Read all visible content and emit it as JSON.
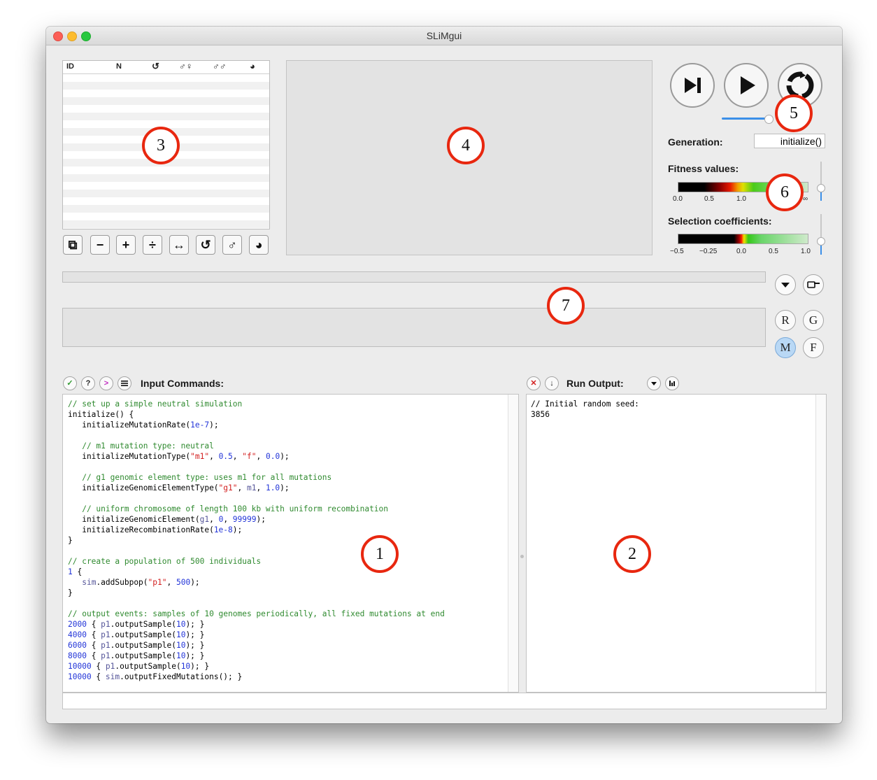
{
  "window": {
    "title": "SLiMgui"
  },
  "subpop_table": {
    "columns": [
      "ID",
      "N",
      "↺",
      "♂♀",
      "♂♂",
      "◕"
    ]
  },
  "toolbar_buttons": [
    "⧉",
    "−",
    "+",
    "÷",
    "↔",
    "↺",
    "♂",
    "◕"
  ],
  "generation": {
    "label": "Generation:",
    "value": "initialize()"
  },
  "fitness": {
    "label": "Fitness values:",
    "ticks": [
      "0.0",
      "0.5",
      "1.0",
      "∞"
    ]
  },
  "selection": {
    "label": "Selection coefficients:",
    "ticks": [
      "−0.5",
      "−0.25",
      "0.0",
      "0.5",
      "1.0"
    ]
  },
  "side_buttons": {
    "r": "R",
    "g": "G",
    "m": "M",
    "f": "F"
  },
  "callouts": [
    "1",
    "2",
    "3",
    "4",
    "5",
    "6",
    "7"
  ],
  "input": {
    "header": "Input Commands:",
    "lines": [
      [
        [
          "cm",
          "// set up a simple neutral simulation"
        ]
      ],
      [
        [
          "",
          "initialize() {"
        ]
      ],
      [
        [
          "",
          "   initializeMutationRate("
        ],
        [
          "num",
          "1e-7"
        ],
        [
          "",
          ");"
        ]
      ],
      [
        [
          "",
          ""
        ]
      ],
      [
        [
          "cm",
          "   // m1 mutation type: neutral"
        ]
      ],
      [
        [
          "",
          "   initializeMutationType("
        ],
        [
          "str",
          "\"m1\""
        ],
        [
          "",
          ", "
        ],
        [
          "num",
          "0.5"
        ],
        [
          "",
          ", "
        ],
        [
          "str",
          "\"f\""
        ],
        [
          "",
          ", "
        ],
        [
          "num",
          "0.0"
        ],
        [
          "",
          ");"
        ]
      ],
      [
        [
          "",
          ""
        ]
      ],
      [
        [
          "cm",
          "   // g1 genomic element type: uses m1 for all mutations"
        ]
      ],
      [
        [
          "",
          "   initializeGenomicElementType("
        ],
        [
          "str",
          "\"g1\""
        ],
        [
          "",
          ", "
        ],
        [
          "kw",
          "m1"
        ],
        [
          "",
          ", "
        ],
        [
          "num",
          "1.0"
        ],
        [
          "",
          ");"
        ]
      ],
      [
        [
          "",
          ""
        ]
      ],
      [
        [
          "cm",
          "   // uniform chromosome of length 100 kb with uniform recombination"
        ]
      ],
      [
        [
          "",
          "   initializeGenomicElement("
        ],
        [
          "kw",
          "g1"
        ],
        [
          "",
          ", "
        ],
        [
          "num",
          "0"
        ],
        [
          "",
          ", "
        ],
        [
          "num",
          "99999"
        ],
        [
          "",
          ");"
        ]
      ],
      [
        [
          "",
          "   initializeRecombinationRate("
        ],
        [
          "num",
          "1e-8"
        ],
        [
          "",
          ");"
        ]
      ],
      [
        [
          "",
          "}"
        ]
      ],
      [
        [
          "",
          ""
        ]
      ],
      [
        [
          "cm",
          "// create a population of 500 individuals"
        ]
      ],
      [
        [
          "num",
          "1"
        ],
        [
          "",
          " {"
        ]
      ],
      [
        [
          "",
          "   "
        ],
        [
          "kw",
          "sim"
        ],
        [
          "",
          ".addSubpop("
        ],
        [
          "str",
          "\"p1\""
        ],
        [
          "",
          ", "
        ],
        [
          "num",
          "500"
        ],
        [
          "",
          ");"
        ]
      ],
      [
        [
          "",
          "}"
        ]
      ],
      [
        [
          "",
          ""
        ]
      ],
      [
        [
          "cm",
          "// output events: samples of 10 genomes periodically, all fixed mutations at end"
        ]
      ],
      [
        [
          "num",
          "2000"
        ],
        [
          "",
          " { "
        ],
        [
          "kw",
          "p1"
        ],
        [
          "",
          ".outputSample("
        ],
        [
          "num",
          "10"
        ],
        [
          "",
          "); }"
        ]
      ],
      [
        [
          "num",
          "4000"
        ],
        [
          "",
          " { "
        ],
        [
          "kw",
          "p1"
        ],
        [
          "",
          ".outputSample("
        ],
        [
          "num",
          "10"
        ],
        [
          "",
          "); }"
        ]
      ],
      [
        [
          "num",
          "6000"
        ],
        [
          "",
          " { "
        ],
        [
          "kw",
          "p1"
        ],
        [
          "",
          ".outputSample("
        ],
        [
          "num",
          "10"
        ],
        [
          "",
          "); }"
        ]
      ],
      [
        [
          "num",
          "8000"
        ],
        [
          "",
          " { "
        ],
        [
          "kw",
          "p1"
        ],
        [
          "",
          ".outputSample("
        ],
        [
          "num",
          "10"
        ],
        [
          "",
          "); }"
        ]
      ],
      [
        [
          "num",
          "10000"
        ],
        [
          "",
          " { "
        ],
        [
          "kw",
          "p1"
        ],
        [
          "",
          ".outputSample("
        ],
        [
          "num",
          "10"
        ],
        [
          "",
          "); }"
        ]
      ],
      [
        [
          "num",
          "10000"
        ],
        [
          "",
          " { "
        ],
        [
          "kw",
          "sim"
        ],
        [
          "",
          ".outputFixedMutations(); }"
        ]
      ]
    ]
  },
  "output": {
    "header": "Run Output:",
    "lines": [
      "// Initial random seed:",
      "3856"
    ]
  },
  "colors": {
    "callout": "#e8270f",
    "comment": "#2f8a2f",
    "number": "#2234d8",
    "string": "#d32020",
    "slider": "#3b8fe8"
  }
}
